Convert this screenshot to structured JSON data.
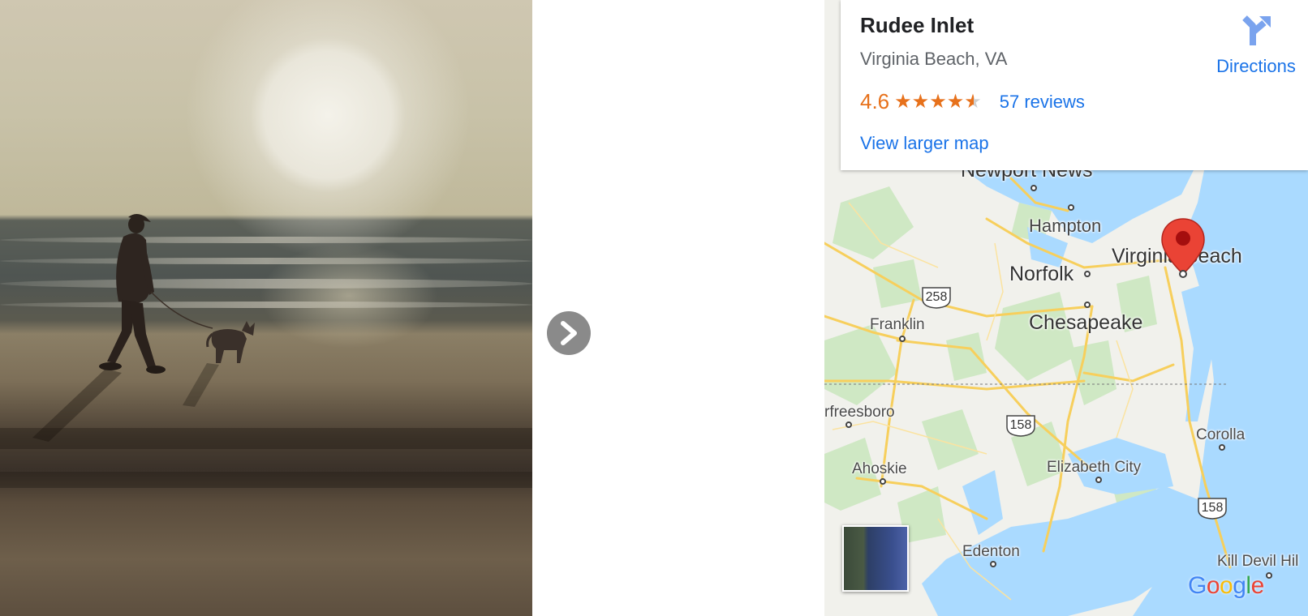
{
  "photo": {
    "description_icon": "beach-photo"
  },
  "navigation": {
    "next_icon": "chevron-right-icon"
  },
  "place": {
    "name": "Rudee Inlet",
    "address": "Virginia Beach, VA",
    "rating": "4.6",
    "stars": 4.6,
    "reviews": "57 reviews",
    "view_larger_map": "View larger map",
    "directions": "Directions",
    "directions_icon": "directions-icon"
  },
  "map": {
    "labels": {
      "newport_news": "Newport News",
      "hampton": "Hampton",
      "norfolk": "Norfolk",
      "virginia_beach": "Virginia Beach",
      "franklin": "Franklin",
      "chesapeake": "Chesapeake",
      "murfreesboro": "rfreesboro",
      "corolla": "Corolla",
      "ahoskie": "Ahoskie",
      "elizabeth_city": "Elizabeth City",
      "edenton": "Edenton",
      "kill_devil_hills": "Kill Devil Hil"
    },
    "shields": {
      "us258": "258",
      "us158_a": "158",
      "us158_b": "158"
    },
    "pin_icon": "map-pin-icon",
    "satellite_toggle_icon": "satellite-view-icon",
    "logo_text": "Google",
    "colors": {
      "water": "#aadaff",
      "land": "#f1f1ec",
      "park": "#c8e6c1",
      "road": "#f9d46b",
      "pin": "#ea4335",
      "link": "#1a73e8",
      "rating": "#e7711b"
    }
  }
}
